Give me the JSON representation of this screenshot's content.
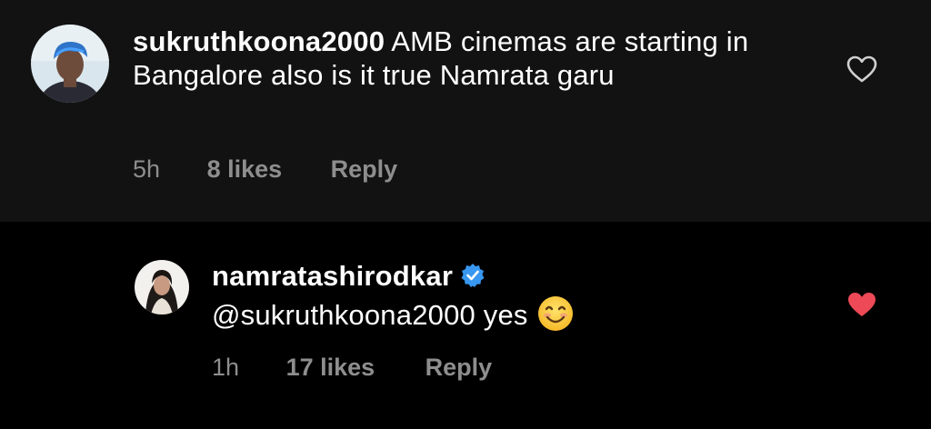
{
  "comments": [
    {
      "username": "sukruthkoona2000",
      "text": " AMB cinemas are starting in Bangalore also is it true Namrata garu",
      "time": "5h",
      "likes": "8 likes",
      "reply_label": "Reply",
      "liked": false,
      "heart_icon": "heart-outline-icon"
    },
    {
      "username": "namratashirodkar",
      "verified": true,
      "text": "@sukruthkoona2000 yes",
      "emoji": "smiling-face-emoji",
      "time": "1h",
      "likes": "17 likes",
      "reply_label": "Reply",
      "liked": true,
      "heart_icon": "heart-filled-icon"
    }
  ],
  "colors": {
    "top_background": "#121212",
    "reply_background": "#000000",
    "text": "#ffffff",
    "meta": "#8e8e8e",
    "liked_heart": "#ed4956",
    "verified_badge": "#3897f0"
  }
}
